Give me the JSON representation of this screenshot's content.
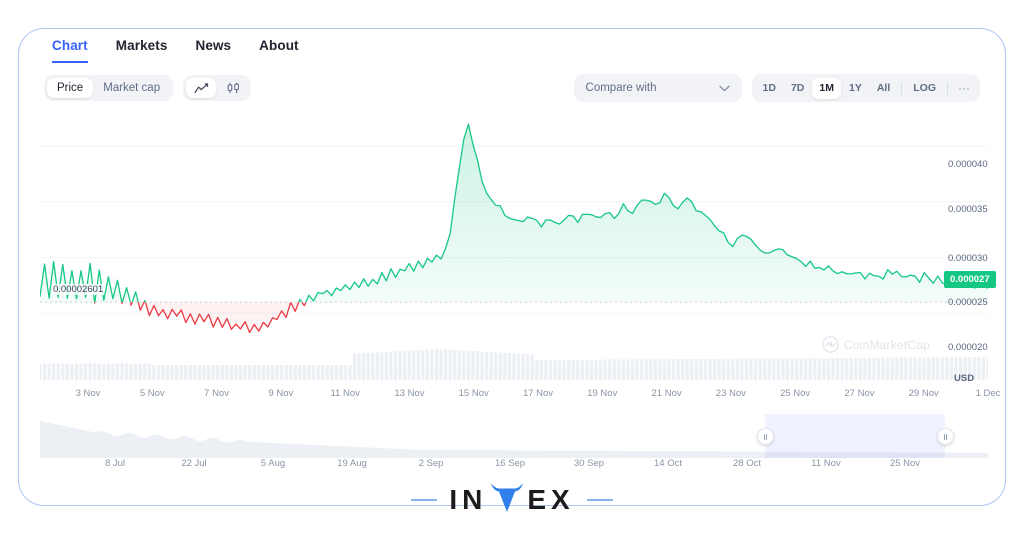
{
  "tabs": [
    {
      "label": "Chart",
      "active": true
    },
    {
      "label": "Markets",
      "active": false
    },
    {
      "label": "News",
      "active": false
    },
    {
      "label": "About",
      "active": false
    }
  ],
  "toolbar": {
    "metric_options": [
      {
        "label": "Price",
        "selected": true
      },
      {
        "label": "Market cap",
        "selected": false
      }
    ],
    "chart_type_icons": [
      {
        "name": "line-chart-icon",
        "selected": true
      },
      {
        "name": "candlestick-chart-icon",
        "selected": false
      }
    ]
  },
  "controls": {
    "compare_label": "Compare with",
    "compare_caret": "chevron-down-icon",
    "ranges": [
      {
        "label": "1D",
        "selected": false
      },
      {
        "label": "7D",
        "selected": false
      },
      {
        "label": "1M",
        "selected": true
      },
      {
        "label": "1Y",
        "selected": false
      },
      {
        "label": "All",
        "selected": false
      }
    ],
    "log_label": "LOG",
    "more_label": "···"
  },
  "watermark": {
    "text": "CoinMarketCap"
  },
  "annotation": {
    "value": "0.00002601"
  },
  "current_price_badge": "0.000027",
  "currency_label": "USD",
  "logo": {
    "text_left": "IN",
    "text_mid": "V",
    "text_right": "EX"
  },
  "colors": {
    "up": "#16c784",
    "down": "#ea3943",
    "accent": "#3861fb",
    "frame": "#aec6f2",
    "axis_text": "#8a94a6"
  },
  "chart_data": {
    "type": "line",
    "title": "",
    "xlabel": "",
    "ylabel": "USD",
    "grid": true,
    "legend": false,
    "ylim": [
      1.85e-05,
      4.25e-05
    ],
    "yticks": [
      "0.000040",
      "0.000035",
      "0.000030",
      "0.000025",
      "0.000020"
    ],
    "ytick_values": [
      4e-05,
      3.5e-05,
      3e-05,
      2.5e-05,
      2e-05
    ],
    "current_value": 2.7e-05,
    "reference_line": 2.601e-05,
    "xticks": [
      "3 Nov",
      "5 Nov",
      "7 Nov",
      "9 Nov",
      "11 Nov",
      "13 Nov",
      "15 Nov",
      "17 Nov",
      "19 Nov",
      "21 Nov",
      "23 Nov",
      "25 Nov",
      "27 Nov",
      "29 Nov",
      "1 Dec"
    ],
    "series": [
      {
        "name": "Price (USD)",
        "color_up": "#16c784",
        "color_down": "#ea3943",
        "values": [
          2.68e-05,
          2.92e-05,
          2.66e-05,
          2.96e-05,
          2.65e-05,
          2.94e-05,
          2.63e-05,
          2.9e-05,
          2.64e-05,
          2.88e-05,
          2.62e-05,
          2.93e-05,
          2.61e-05,
          2.86e-05,
          2.6e-05,
          2.83e-05,
          2.61e-05,
          2.8e-05,
          2.58e-05,
          2.74e-05,
          2.56e-05,
          2.69e-05,
          2.52e-05,
          2.62e-05,
          2.5e-05,
          2.58e-05,
          2.48e-05,
          2.56e-05,
          2.47e-05,
          2.54e-05,
          2.45e-05,
          2.52e-05,
          2.43e-05,
          2.5e-05,
          2.42e-05,
          2.49e-05,
          2.4e-05,
          2.47e-05,
          2.38e-05,
          2.45e-05,
          2.37e-05,
          2.43e-05,
          2.36e-05,
          2.42e-05,
          2.35e-05,
          2.41e-05,
          2.34e-05,
          2.4e-05,
          2.36e-05,
          2.44e-05,
          2.39e-05,
          2.48e-05,
          2.43e-05,
          2.52e-05,
          2.47e-05,
          2.58e-05,
          2.52e-05,
          2.64e-05,
          2.58e-05,
          2.68e-05,
          2.63e-05,
          2.71e-05,
          2.66e-05,
          2.73e-05,
          2.68e-05,
          2.75e-05,
          2.7e-05,
          2.77e-05,
          2.72e-05,
          2.79e-05,
          2.74e-05,
          2.81e-05,
          2.76e-05,
          2.83e-05,
          2.78e-05,
          2.86e-05,
          2.81e-05,
          2.89e-05,
          2.84e-05,
          2.92e-05,
          2.87e-05,
          2.95e-05,
          2.9e-05,
          2.98e-05,
          2.93e-05,
          3e-05,
          2.96e-05,
          3.03e-05,
          2.99e-05,
          3.06e-05,
          3.2e-05,
          3.55e-05,
          3.8e-05,
          4.05e-05,
          4.18e-05,
          4e-05,
          3.85e-05,
          3.7e-05,
          3.6e-05,
          3.52e-05,
          3.48e-05,
          3.44e-05,
          3.4e-05,
          3.37e-05,
          3.34e-05,
          3.31e-05,
          3.33e-05,
          3.36e-05,
          3.34e-05,
          3.31e-05,
          3.29e-05,
          3.33e-05,
          3.36e-05,
          3.34e-05,
          3.3e-05,
          3.34e-05,
          3.38e-05,
          3.35e-05,
          3.32e-05,
          3.36e-05,
          3.4e-05,
          3.37e-05,
          3.34e-05,
          3.38e-05,
          3.42e-05,
          3.39e-05,
          3.36e-05,
          3.41e-05,
          3.46e-05,
          3.43e-05,
          3.4e-05,
          3.45e-05,
          3.5e-05,
          3.54e-05,
          3.5e-05,
          3.46e-05,
          3.51e-05,
          3.56e-05,
          3.52e-05,
          3.48e-05,
          3.44e-05,
          3.48e-05,
          3.52e-05,
          3.48e-05,
          3.44e-05,
          3.4e-05,
          3.36e-05,
          3.32e-05,
          3.28e-05,
          3.24e-05,
          3.2e-05,
          3.16e-05,
          3.12e-05,
          3.16e-05,
          3.2e-05,
          3.17e-05,
          3.14e-05,
          3.11e-05,
          3.08e-05,
          3.05e-05,
          3.02e-05,
          3.06e-05,
          3.1e-05,
          3.07e-05,
          3.04e-05,
          3.01e-05,
          2.98e-05,
          2.95e-05,
          2.92e-05,
          2.96e-05,
          2.93e-05,
          2.9e-05,
          2.87e-05,
          2.91e-05,
          2.88e-05,
          2.85e-05,
          2.89e-05,
          2.86e-05,
          2.83e-05,
          2.87e-05,
          2.84e-05,
          2.81e-05,
          2.85e-05,
          2.82e-05,
          2.86e-05,
          2.83e-05,
          2.87e-05,
          2.84e-05,
          2.88e-05,
          2.85e-05,
          2.82e-05,
          2.86e-05,
          2.83e-05,
          2.8e-05,
          2.84e-05,
          2.81e-05,
          2.78e-05,
          2.82e-05,
          2.79e-05,
          2.76e-05,
          2.8e-05,
          2.77e-05,
          2.74e-05,
          2.78e-05,
          2.75e-05,
          2.72e-05,
          2.76e-05,
          2.73e-05,
          2.7e-05
        ]
      }
    ],
    "volume": {
      "name": "Volume",
      "color": "#eceff4"
    },
    "navigator": {
      "xticks": [
        "8 Jul",
        "22 Jul",
        "5 Aug",
        "19 Aug",
        "2 Sep",
        "16 Sep",
        "30 Sep",
        "14 Oct",
        "28 Oct",
        "11 Nov",
        "25 Nov"
      ],
      "selection_start_pct": 76.5,
      "selection_end_pct": 95.5
    }
  }
}
